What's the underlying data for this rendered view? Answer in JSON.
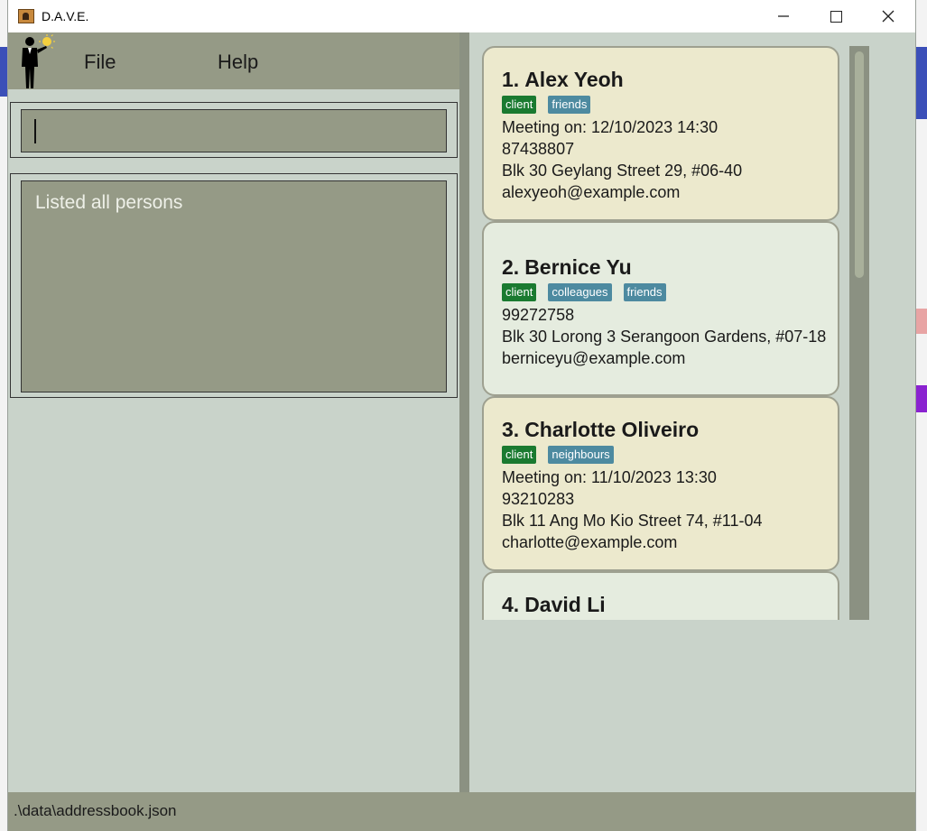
{
  "window": {
    "title": "D.A.V.E."
  },
  "menu": {
    "file": "File",
    "help": "Help"
  },
  "command_box": {
    "value": ""
  },
  "result_display": {
    "text": "Listed all persons"
  },
  "persons": [
    {
      "index": "1.",
      "name": "Alex Yeoh",
      "tags": [
        "client",
        "friends"
      ],
      "meeting": "Meeting on: 12/10/2023 14:30",
      "phone": "87438807",
      "address": "Blk 30 Geylang Street 29, #06-40",
      "email": "alexyeoh@example.com"
    },
    {
      "index": "2.",
      "name": "Bernice Yu",
      "tags": [
        "client",
        "colleagues",
        "friends"
      ],
      "meeting": "",
      "phone": "99272758",
      "address": "Blk 30 Lorong 3 Serangoon Gardens, #07-18",
      "email": "berniceyu@example.com"
    },
    {
      "index": "3.",
      "name": "Charlotte Oliveiro",
      "tags": [
        "client",
        "neighbours"
      ],
      "meeting": "Meeting on: 11/10/2023 13:30",
      "phone": "93210283",
      "address": "Blk 11 Ang Mo Kio Street 74, #11-04",
      "email": "charlotte@example.com"
    },
    {
      "index": "4.",
      "name": "David Li",
      "tags": [],
      "meeting": "",
      "phone": "",
      "address": "",
      "email": ""
    }
  ],
  "status_bar": {
    "path": ".\\data\\addressbook.json"
  },
  "colors": {
    "menu_bg": "#959a86",
    "pane_bg": "#c9d3ca",
    "meeting_card": "#ece9cd",
    "plain_card": "#e5ecdf",
    "tag_client": "#1a7a30",
    "tag_other": "#4d8aa0"
  },
  "icons": {
    "app": "address-book-icon",
    "logo": "businessman-idea-icon",
    "minimize": "minimize-icon",
    "maximize": "maximize-icon",
    "close": "close-icon"
  }
}
